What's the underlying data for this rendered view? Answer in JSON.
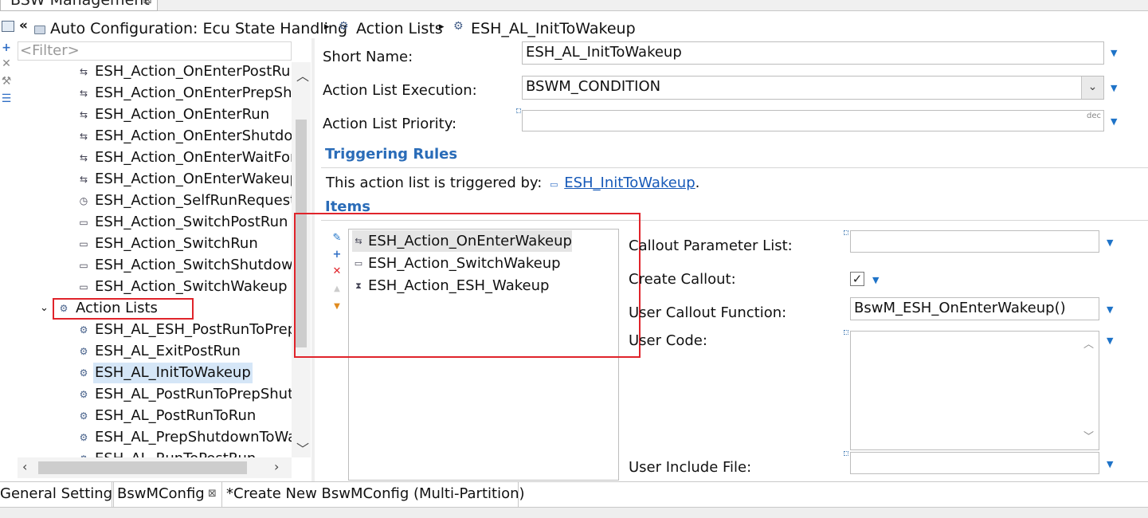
{
  "window": {
    "tab_title": "BSW Management"
  },
  "breadcrumb": {
    "items": [
      "Auto Configuration: Ecu State Handling",
      "Action Lists",
      "ESH_AL_InitToWakeup"
    ]
  },
  "tree": {
    "filter_placeholder": "<Filter>",
    "actions": [
      "ESH_Action_OnEnterPostRun",
      "ESH_Action_OnEnterPrepShu",
      "ESH_Action_OnEnterRun",
      "ESH_Action_OnEnterShutdow",
      "ESH_Action_OnEnterWaitFor",
      "ESH_Action_OnEnterWakeup",
      "ESH_Action_SelfRunRequestT",
      "ESH_Action_SwitchPostRun",
      "ESH_Action_SwitchRun",
      "ESH_Action_SwitchShutdown",
      "ESH_Action_SwitchWakeup"
    ],
    "group_label": "Action Lists",
    "action_lists": [
      "ESH_AL_ESH_PostRunToPrep",
      "ESH_AL_ExitPostRun",
      "ESH_AL_InitToWakeup",
      "ESH_AL_PostRunToPrepShutc",
      "ESH_AL_PostRunToRun",
      "ESH_AL_PrepShutdownToWa",
      "ESH_AL_RunToPostRun"
    ],
    "selected": "ESH_AL_InitToWakeup"
  },
  "form": {
    "short_name_label": "Short Name:",
    "short_name_value": "ESH_AL_InitToWakeup",
    "execution_label": "Action List Execution:",
    "execution_value": "BSWM_CONDITION",
    "priority_label": "Action List Priority:",
    "priority_value": "",
    "priority_hint": "dec",
    "triggering_title": "Triggering Rules",
    "triggered_by_text": "This action list is triggered by:",
    "triggered_by_link": "ESH_InitToWakeup",
    "items_title": "Items"
  },
  "items": [
    "ESH_Action_OnEnterWakeup",
    "ESH_Action_SwitchWakeup",
    "ESH_Action_ESH_Wakeup"
  ],
  "item_detail": {
    "callout_param_label": "Callout Parameter List:",
    "callout_param_value": "",
    "create_callout_label": "Create Callout:",
    "create_callout_checked": true,
    "user_callout_label": "User Callout Function:",
    "user_callout_value": "BswM_ESH_OnEnterWakeup()",
    "user_code_label": "User Code:",
    "user_code_value": "",
    "user_include_label": "User Include File:",
    "user_include_value": ""
  },
  "bottom_tabs": [
    "General Settings",
    "BswMConfig",
    "*Create New BswMConfig (Multi-Partition)"
  ],
  "colors": {
    "accent": "#2a6cb8",
    "link": "#1659b8",
    "highlight_box": "#e0242b",
    "selection": "#d5e6f7"
  }
}
